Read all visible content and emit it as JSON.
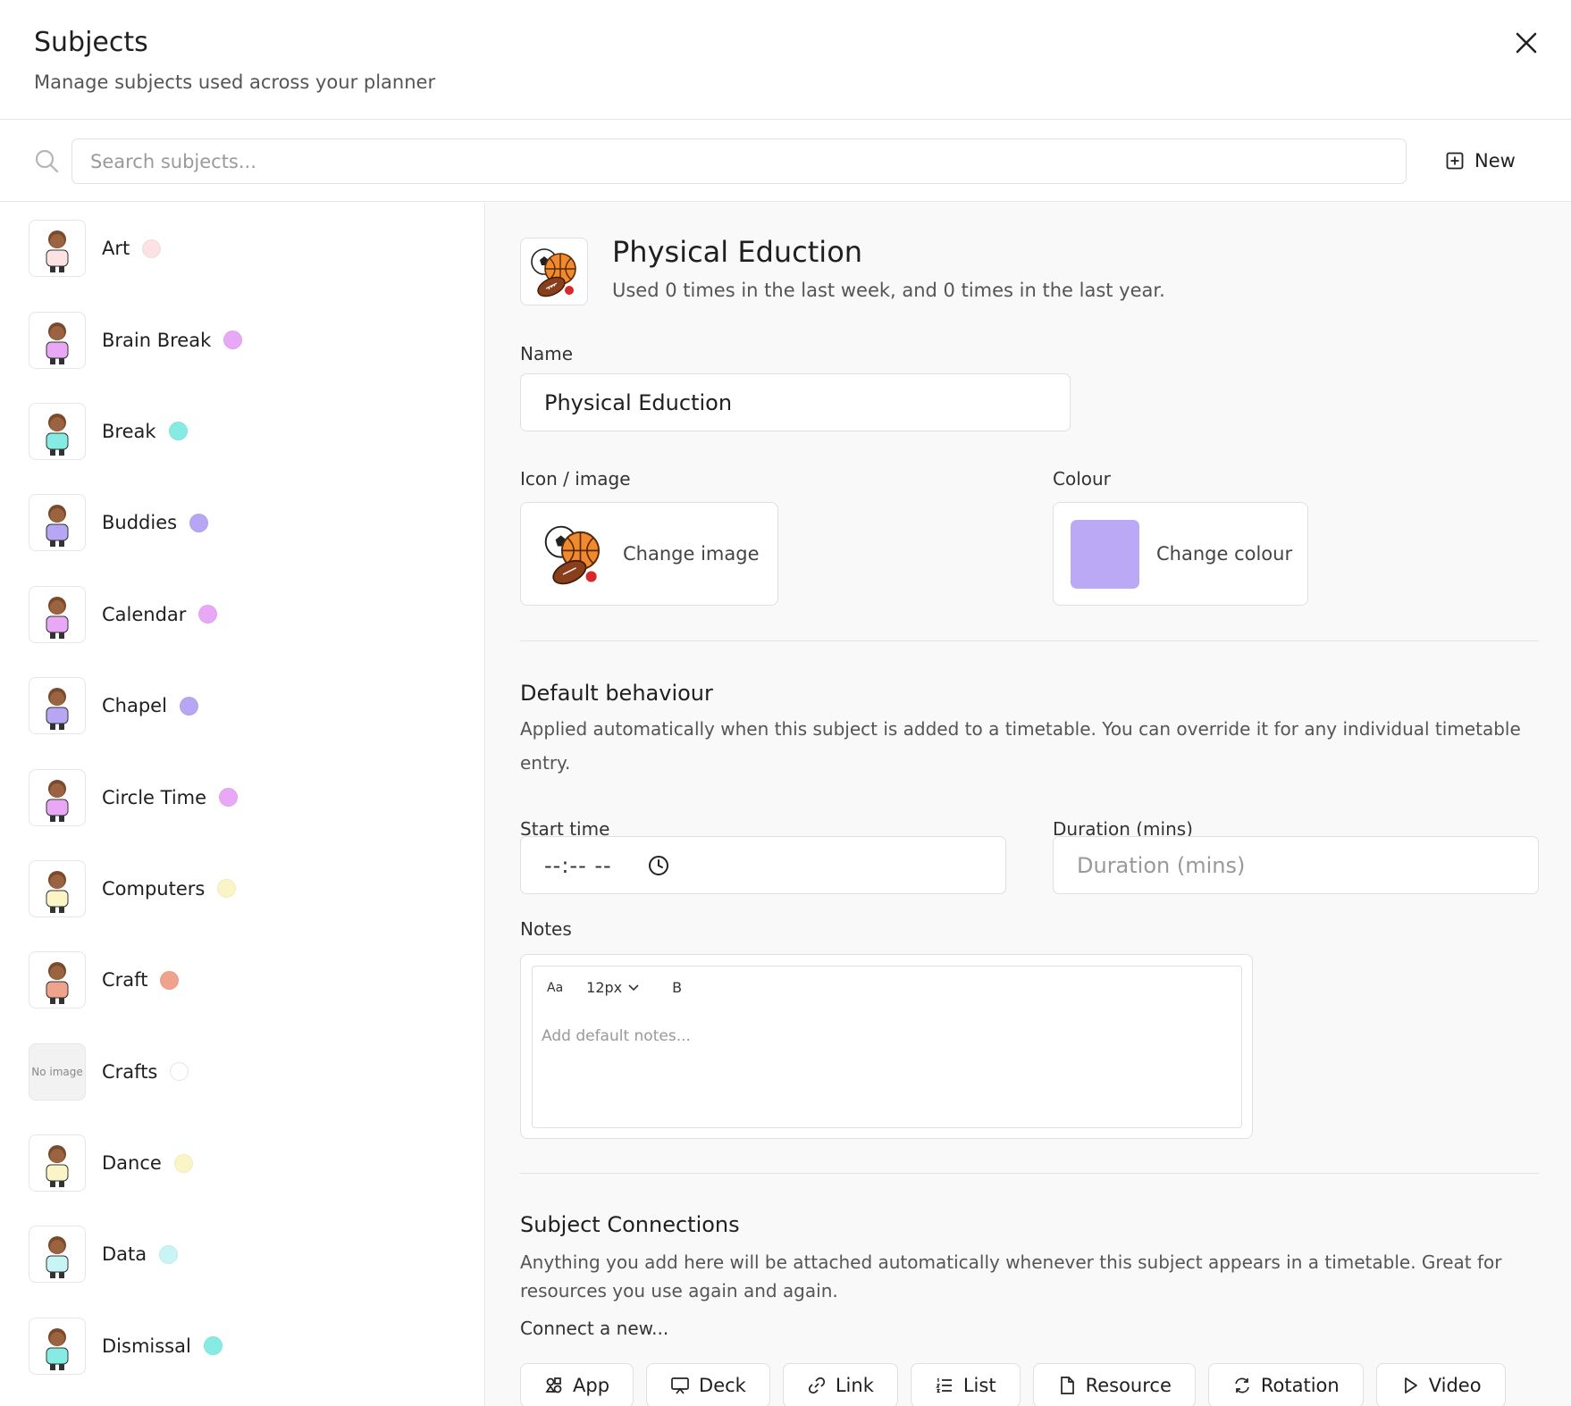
{
  "header": {
    "title": "Subjects",
    "subtitle": "Manage subjects used across your planner"
  },
  "search": {
    "placeholder": "Search subjects...",
    "value": ""
  },
  "toolbar": {
    "new_label": "New"
  },
  "subjects": [
    {
      "name": "Art",
      "color": "#fbe3e3",
      "icon": "art-image"
    },
    {
      "name": "Brain Break",
      "color": "#e9a8f5",
      "icon": "brain-break-image"
    },
    {
      "name": "Break",
      "color": "#86ece3",
      "icon": "break-image"
    },
    {
      "name": "Buddies",
      "color": "#b7a6f4",
      "icon": "buddies-image"
    },
    {
      "name": "Calendar",
      "color": "#e9a8f5",
      "icon": "calendar-image"
    },
    {
      "name": "Chapel",
      "color": "#b7a6f4",
      "icon": "chapel-image"
    },
    {
      "name": "Circle Time",
      "color": "#e9a8f5",
      "icon": "circle-time-image"
    },
    {
      "name": "Computers",
      "color": "#fbf4c6",
      "icon": "computers-image"
    },
    {
      "name": "Craft",
      "color": "#efa38c",
      "icon": "craft-image"
    },
    {
      "name": "Crafts",
      "color": "#ffffff",
      "icon": "no-image",
      "no_image_text": "No image"
    },
    {
      "name": "Dance",
      "color": "#fbf4c6",
      "icon": "dance-image"
    },
    {
      "name": "Data",
      "color": "#c9f4f6",
      "icon": "data-image"
    },
    {
      "name": "Dismissal",
      "color": "#86ece3",
      "icon": "dismissal-image"
    }
  ],
  "detail": {
    "title": "Physical Eduction",
    "usage": "Used 0 times in the last week, and 0 times in the last year.",
    "name_label": "Name",
    "name_value": "Physical Eduction",
    "icon_label": "Icon / image",
    "change_image_label": "Change image",
    "colour_label": "Colour",
    "change_colour_label": "Change colour",
    "colour": "#bca9f5"
  },
  "default_behaviour": {
    "title": "Default behaviour",
    "description": "Applied automatically when this subject is added to a timetable. You can override it for any individual timetable entry.",
    "start_time_label": "Start time",
    "start_time_value": "--:-- --",
    "duration_label": "Duration (mins)",
    "duration_placeholder": "Duration (mins)",
    "notes_label": "Notes",
    "notes_font_button": "Aa",
    "notes_size": "12px",
    "notes_bold": "B",
    "notes_placeholder": "Add default notes..."
  },
  "connections": {
    "title": "Subject Connections",
    "description": "Anything you add here will be attached automatically whenever this subject appears in a timetable. Great for resources you use again and again.",
    "connect_label": "Connect a new...",
    "buttons": [
      {
        "label": "App",
        "icon": "app-icon"
      },
      {
        "label": "Deck",
        "icon": "deck-icon"
      },
      {
        "label": "Link",
        "icon": "link-icon"
      },
      {
        "label": "List",
        "icon": "list-icon"
      },
      {
        "label": "Resource",
        "icon": "resource-icon"
      },
      {
        "label": "Rotation",
        "icon": "rotation-icon"
      },
      {
        "label": "Video",
        "icon": "video-icon"
      }
    ]
  }
}
